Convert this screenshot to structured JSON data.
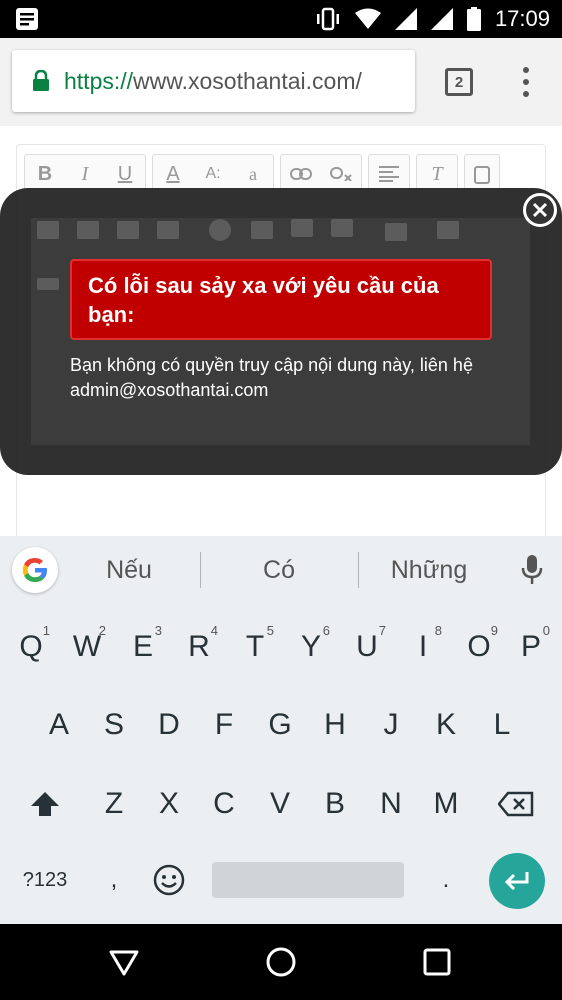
{
  "status_bar": {
    "time": "17:09"
  },
  "browser": {
    "url_scheme": "https://",
    "url_host": "www.xosothantai.com/",
    "tab_count": "2"
  },
  "editor_toolbar": {
    "buttons": [
      "B",
      "I",
      "U",
      "A",
      "A:",
      "a",
      "",
      "",
      "",
      "T"
    ]
  },
  "modal": {
    "error_title": "Có lỗi sau sảy xa với yêu cầu của bạn:",
    "error_message": "Bạn không có quyền truy cập nội dung này, liên hệ admin@xosothantai.com"
  },
  "suggestions": [
    "Nếu",
    "Có",
    "Những"
  ],
  "keyboard": {
    "row1": [
      {
        "k": "Q",
        "h": "1"
      },
      {
        "k": "W",
        "h": "2"
      },
      {
        "k": "E",
        "h": "3"
      },
      {
        "k": "R",
        "h": "4"
      },
      {
        "k": "T",
        "h": "5"
      },
      {
        "k": "Y",
        "h": "6"
      },
      {
        "k": "U",
        "h": "7"
      },
      {
        "k": "I",
        "h": "8"
      },
      {
        "k": "O",
        "h": "9"
      },
      {
        "k": "P",
        "h": "0"
      }
    ],
    "row2": [
      "A",
      "S",
      "D",
      "F",
      "G",
      "H",
      "J",
      "K",
      "L"
    ],
    "row3": [
      "Z",
      "X",
      "C",
      "V",
      "B",
      "N",
      "M"
    ],
    "symbols_label": "?123",
    "comma": ",",
    "period": "."
  },
  "colors": {
    "error_bg": "#c00000",
    "enter_key": "#26a69a",
    "secure_green": "#0b8043"
  }
}
